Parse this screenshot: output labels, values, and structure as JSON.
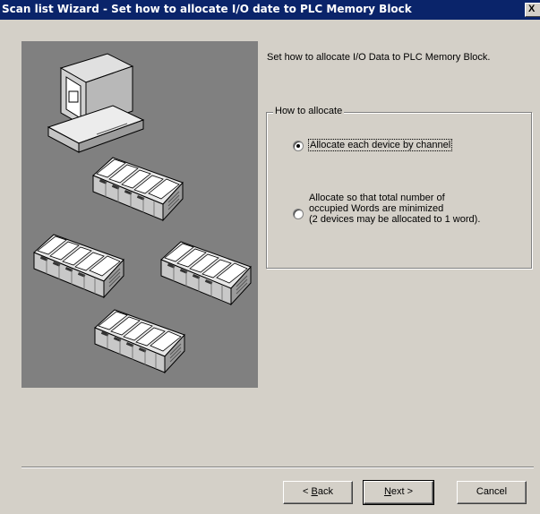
{
  "window": {
    "title": "Scan list Wizard - Set how to allocate I/O date to PLC Memory Block",
    "close_label": "X"
  },
  "content": {
    "instruction": "Set how to allocate I/O Data to PLC Memory Block."
  },
  "groupbox": {
    "legend": "How to allocate",
    "option1": {
      "label": "Allocate each device by channel",
      "selected": true
    },
    "option2": {
      "lines": [
        "Allocate so that total number of",
        "occupied Words are minimized",
        "(2 devices may be allocated to 1 word)."
      ],
      "selected": false
    }
  },
  "buttons": {
    "back": {
      "prefix": "< ",
      "accel": "B",
      "rest": "ack"
    },
    "next": {
      "accel": "N",
      "rest": "ext >"
    },
    "cancel": "Cancel"
  },
  "colors": {
    "titlebar": "#0a246a",
    "dialog": "#d4d0c8",
    "art_panel": "#808080"
  },
  "icons": {
    "computer": "computer-icon",
    "plc": "plc-unit-icon"
  }
}
